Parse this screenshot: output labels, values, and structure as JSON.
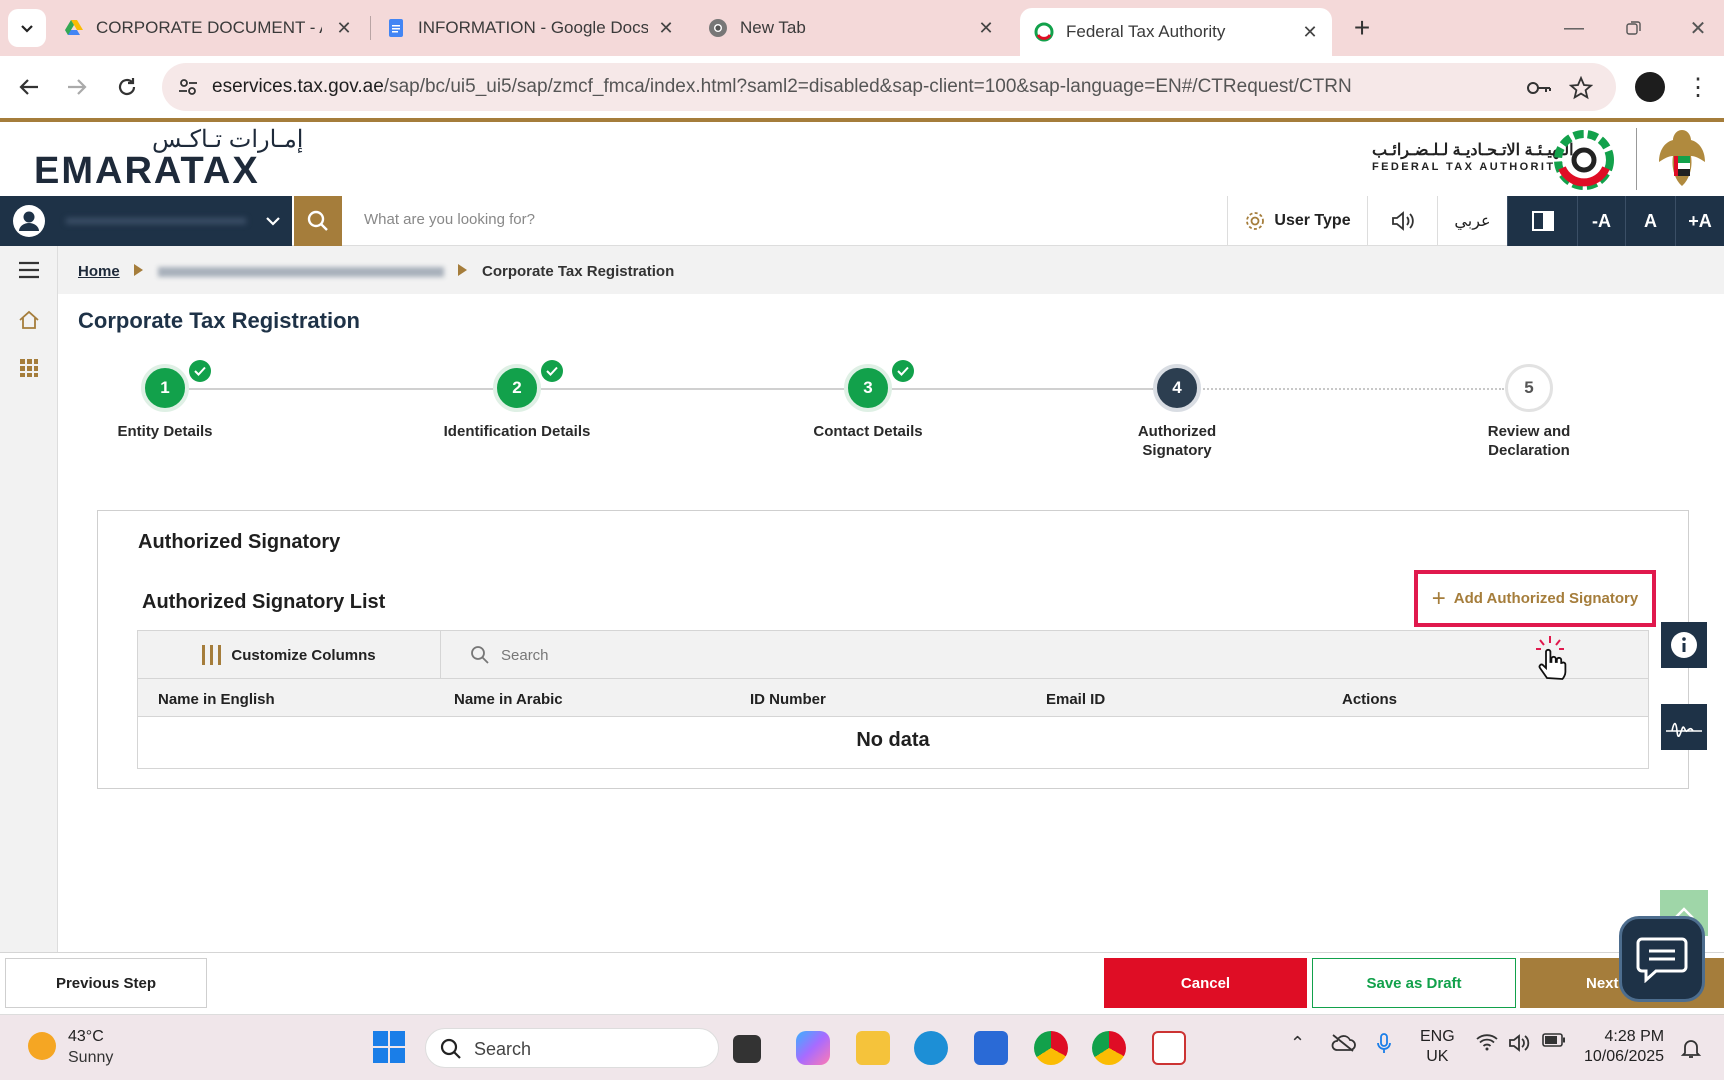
{
  "browser": {
    "tabs": [
      {
        "title": "CORPORATE DOCUMENT - Acc",
        "active": false
      },
      {
        "title": "INFORMATION - Google Docs",
        "active": false
      },
      {
        "title": "New Tab",
        "active": false
      },
      {
        "title": "Federal Tax Authority",
        "active": true
      }
    ],
    "url_host": "eservices.tax.gov.ae",
    "url_path": "/sap/bc/ui5_ui5/sap/zmcf_fmca/index.html?saml2=disabled&sap-client=100&sap-language=EN#/CTRequest/CTRN"
  },
  "header": {
    "logo_arabic": "إمـارات تـاكـس",
    "logo_english": "EMARATAX",
    "fta_arabic": "الـهيـئـة الاتـحـاديـة لـلـضـرائـب",
    "fta_english": "FEDERAL TAX AUTHORITY"
  },
  "navbar": {
    "search_placeholder": "What are you looking for?",
    "user_type_label": "User Type",
    "arabic_label": "عربي",
    "font_decrease": "-A",
    "font_normal": "A",
    "font_increase": "+A"
  },
  "breadcrumb": {
    "home": "Home",
    "current": "Corporate Tax Registration"
  },
  "page": {
    "title": "Corporate Tax Registration"
  },
  "stepper": {
    "steps": [
      {
        "number": "1",
        "label": "Entity Details",
        "status": "done"
      },
      {
        "number": "2",
        "label": "Identification Details",
        "status": "done"
      },
      {
        "number": "3",
        "label": "Contact Details",
        "status": "done"
      },
      {
        "number": "4",
        "label": "Authorized Signatory",
        "status": "current"
      },
      {
        "number": "5",
        "label": "Review and Declaration",
        "status": "todo"
      }
    ]
  },
  "panel": {
    "title": "Authorized Signatory",
    "list_title": "Authorized Signatory List",
    "add_button": "Add Authorized Signatory",
    "customize_columns": "Customize Columns",
    "search_placeholder": "Search",
    "columns": [
      "Name in English",
      "Name in Arabic",
      "ID Number",
      "Email ID",
      "Actions"
    ],
    "empty_text": "No data"
  },
  "footer": {
    "previous": "Previous Step",
    "cancel": "Cancel",
    "save_draft": "Save as Draft",
    "next": "Next"
  },
  "taskbar": {
    "temperature": "43°C",
    "weather": "Sunny",
    "search": "Search",
    "lang_line1": "ENG",
    "lang_line2": "UK",
    "time": "4:28 PM",
    "date": "10/06/2025"
  },
  "colors": {
    "brand_navy": "#1e3247",
    "brand_gold": "#a57d3b",
    "success_green": "#12a14b",
    "cancel_red": "#df0d25",
    "highlight_pink": "#e0194d"
  }
}
